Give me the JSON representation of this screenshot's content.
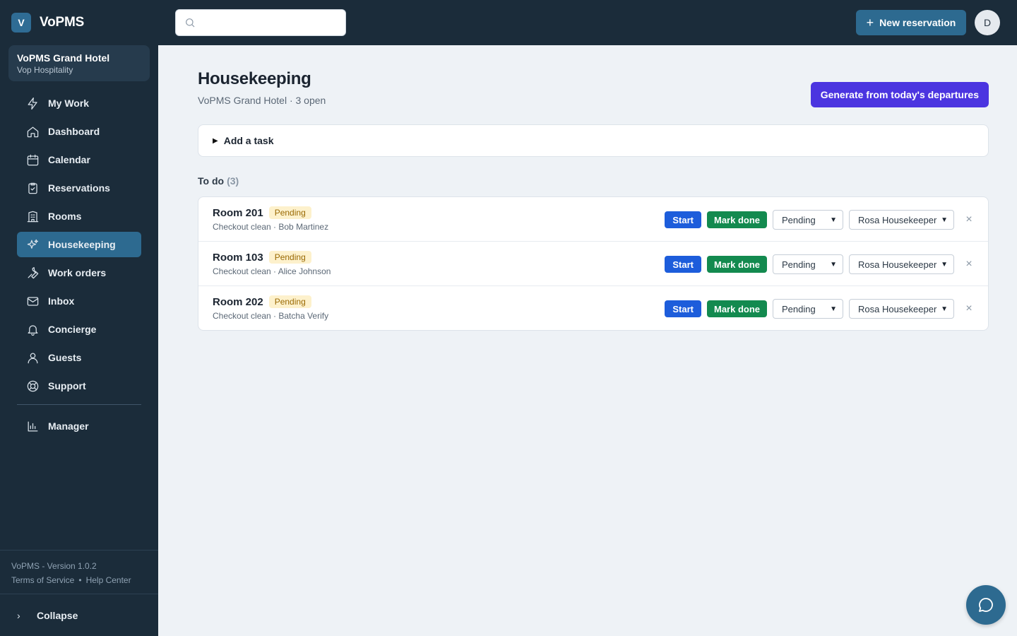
{
  "app": {
    "logo_letter": "V",
    "name": "VoPMS"
  },
  "hotel": {
    "name": "VoPMS Grand Hotel",
    "org": "Vop Hospitality"
  },
  "sidebar": {
    "items": [
      {
        "label": "My Work",
        "icon": "bolt-icon"
      },
      {
        "label": "Dashboard",
        "icon": "home-icon"
      },
      {
        "label": "Calendar",
        "icon": "calendar-icon"
      },
      {
        "label": "Reservations",
        "icon": "clipboard-check-icon"
      },
      {
        "label": "Rooms",
        "icon": "building-icon"
      },
      {
        "label": "Housekeeping",
        "icon": "sparkles-icon",
        "active": true
      },
      {
        "label": "Work orders",
        "icon": "wrench-icon"
      },
      {
        "label": "Inbox",
        "icon": "mail-icon"
      },
      {
        "label": "Concierge",
        "icon": "bell-icon"
      },
      {
        "label": "Guests",
        "icon": "user-icon"
      },
      {
        "label": "Support",
        "icon": "lifebuoy-icon"
      }
    ],
    "manager_label": "Manager",
    "version": "VoPMS - Version 1.0.2",
    "terms": "Terms of Service",
    "help": "Help Center",
    "collapse_label": "Collapse"
  },
  "topbar": {
    "search_placeholder": "",
    "new_reservation": "New reservation",
    "avatar_initial": "D"
  },
  "page": {
    "title": "Housekeeping",
    "subtitle": "VoPMS Grand Hotel · 3 open",
    "generate_button": "Generate from today's departures",
    "add_task": "Add a task",
    "section_title": "To do",
    "section_count": "(3)"
  },
  "tasks": [
    {
      "room": "Room 201",
      "status": "Pending",
      "desc": "Checkout clean · Bob Martinez",
      "start": "Start",
      "done": "Mark done",
      "status_select": "Pending",
      "assignee": "Rosa Housekeeper"
    },
    {
      "room": "Room 103",
      "status": "Pending",
      "desc": "Checkout clean · Alice Johnson",
      "start": "Start",
      "done": "Mark done",
      "status_select": "Pending",
      "assignee": "Rosa Housekeeper"
    },
    {
      "room": "Room 202",
      "status": "Pending",
      "desc": "Checkout clean · Batcha Verify",
      "start": "Start",
      "done": "Mark done",
      "status_select": "Pending",
      "assignee": "Rosa Housekeeper"
    }
  ],
  "colors": {
    "sidebar_bg": "#1b2c3a",
    "accent": "#2d6a90",
    "generate_btn": "#4b35e0",
    "start_btn": "#1d5ddb",
    "done_btn": "#138a4f",
    "pending_badge_bg": "#fdf1cc"
  }
}
